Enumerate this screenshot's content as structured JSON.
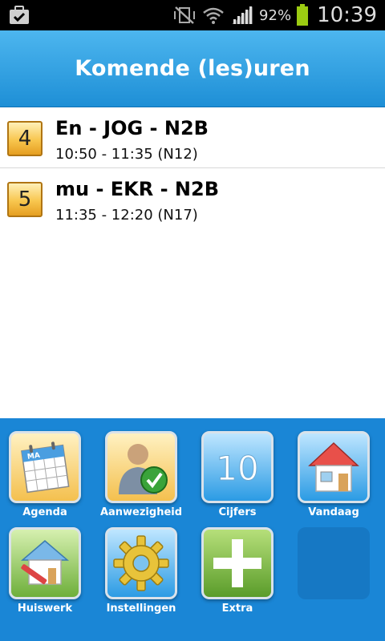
{
  "status_bar": {
    "battery_percent": "92%",
    "time": "10:39",
    "icons": [
      "briefcase-check-icon",
      "vibrate-mute-icon",
      "wifi-icon",
      "signal-icon",
      "battery-icon"
    ]
  },
  "header": {
    "title": "Komende (les)uren"
  },
  "lessons": [
    {
      "number": "4",
      "title": "En - JOG - N2B",
      "time": "10:50 - 11:35 (N12)"
    },
    {
      "number": "5",
      "title": "mu - EKR - N2B",
      "time": "11:35 - 12:20 (N17)"
    }
  ],
  "dock": {
    "items": [
      {
        "label": "Agenda",
        "icon": "calendar-icon",
        "calendar_day": "MA"
      },
      {
        "label": "Aanwezigheid",
        "icon": "person-check-icon"
      },
      {
        "label": "Cijfers",
        "icon": "grade-10-icon",
        "badge": "10"
      },
      {
        "label": "Vandaag",
        "icon": "house-icon"
      },
      {
        "label": "Huiswerk",
        "icon": "house-pencil-icon"
      },
      {
        "label": "Instellingen",
        "icon": "gear-icon"
      },
      {
        "label": "Extra",
        "icon": "plus-icon"
      }
    ]
  },
  "colors": {
    "header": "#1e8fd6",
    "dock": "#1a86d6",
    "lesson_badge": "#f8c64e"
  }
}
